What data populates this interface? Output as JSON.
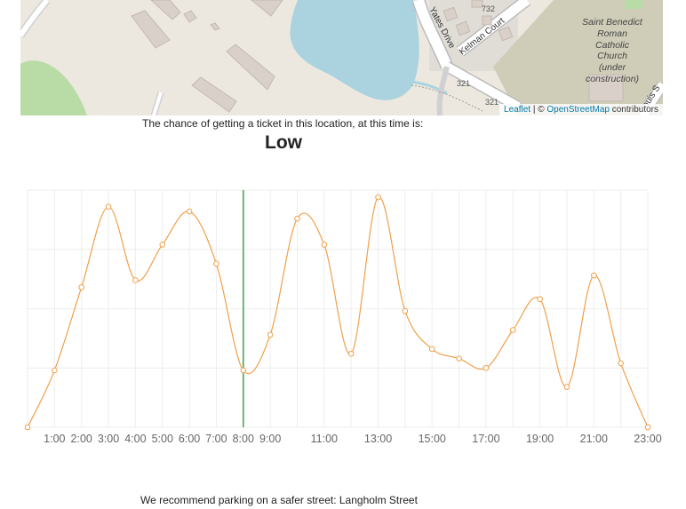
{
  "map": {
    "streets": {
      "yates": "Yates Drive",
      "kelman": "Kelman Court"
    },
    "church": [
      "Saint Benedict",
      "Roman",
      "Catholic",
      "Church",
      "(under",
      "construction)"
    ],
    "numbers": {
      "a": "732",
      "b": "321",
      "c": "321"
    },
    "partial_label": "ouis S",
    "attribution": {
      "leaflet": "Leaflet",
      "sep": " | © ",
      "osm": "OpenStreetMap",
      "contrib": " contributors"
    },
    "colors": {
      "land": "#ece8e0",
      "water": "#aad3df",
      "building": "#d9d0c9",
      "park": "#b9dca6",
      "church_area": "#cfcdb8"
    }
  },
  "chance_text": "The chance of getting a ticket in this location, at this time is:",
  "risk_level": "Low",
  "recommendation": "We recommend parking on a safer street: Langholm Street",
  "chart_data": {
    "type": "line",
    "x": [
      0,
      1,
      2,
      3,
      4,
      5,
      6,
      7,
      8,
      9,
      10,
      11,
      12,
      13,
      14,
      15,
      16,
      17,
      18,
      19,
      20,
      21,
      22,
      23
    ],
    "values": [
      0,
      0.24,
      0.59,
      0.93,
      0.62,
      0.77,
      0.91,
      0.69,
      0.24,
      0.39,
      0.88,
      0.77,
      0.31,
      0.97,
      0.49,
      0.33,
      0.29,
      0.25,
      0.41,
      0.54,
      0.17,
      0.64,
      0.27,
      0
    ],
    "tick_labels": {
      "1": "1:00",
      "2": "2:00",
      "3": "3:00",
      "4": "4:00",
      "5": "5:00",
      "6": "6:00",
      "7": "7:00",
      "8": "8:00",
      "9": "9:00",
      "11": "11:00",
      "13": "13:00",
      "15": "15:00",
      "17": "17:00",
      "19": "19:00",
      "21": "21:00",
      "23": "23:00"
    },
    "current_hour": 8,
    "ylim": [
      0,
      1
    ],
    "xlim": [
      0,
      23
    ],
    "grid": true,
    "colors": {
      "line": "#f0a04b",
      "marker_fill": "#ffffff",
      "current": "#3fa444",
      "grid": "#eeeeee"
    }
  }
}
